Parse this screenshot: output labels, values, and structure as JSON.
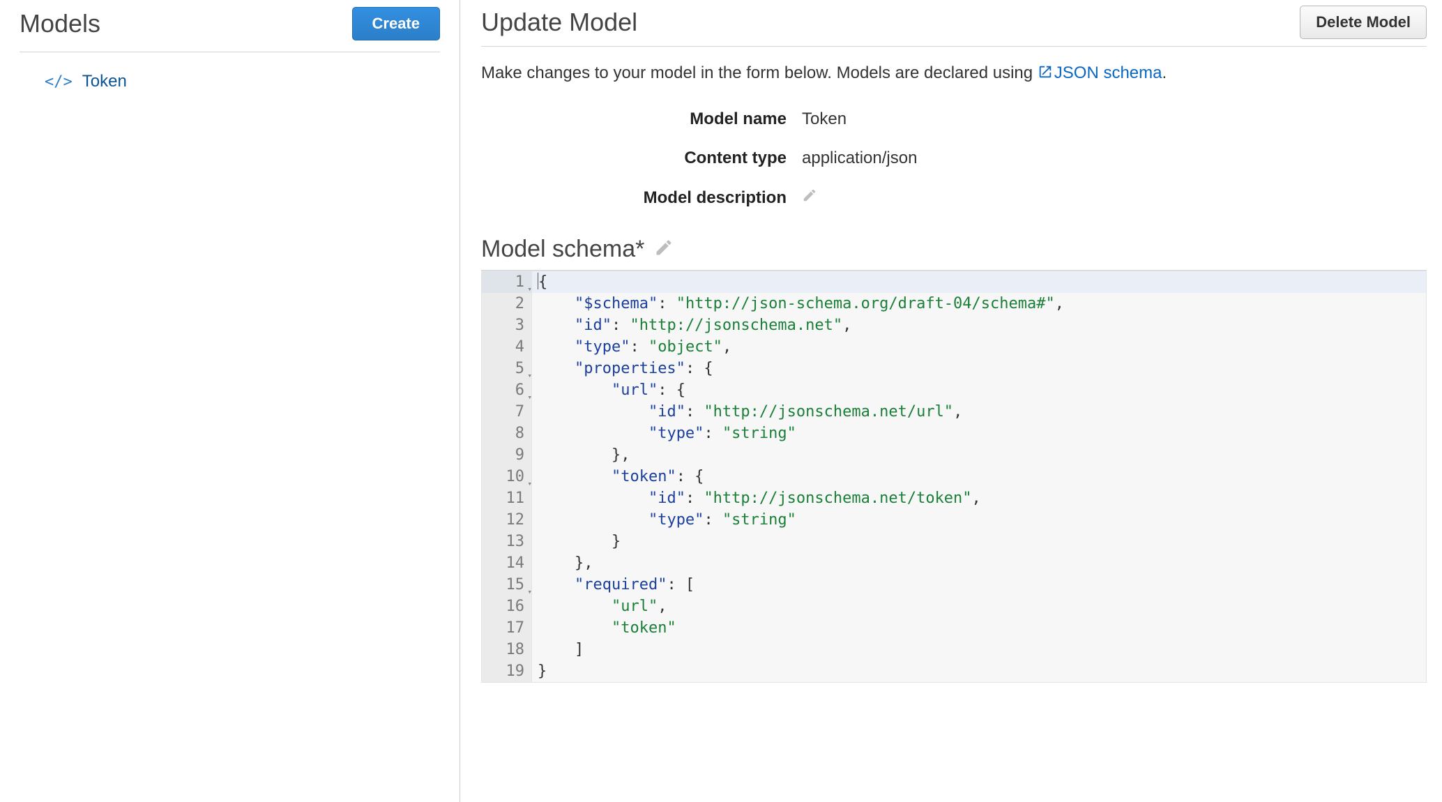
{
  "sidebar": {
    "title": "Models",
    "create_label": "Create",
    "items": [
      {
        "label": "Token",
        "icon": "code-icon"
      }
    ]
  },
  "main": {
    "title": "Update Model",
    "delete_label": "Delete Model",
    "description_prefix": "Make changes to your model in the form below. Models are declared using ",
    "schema_link_text": "JSON schema",
    "description_suffix": ".",
    "fields": {
      "model_name_label": "Model name",
      "model_name_value": "Token",
      "content_type_label": "Content type",
      "content_type_value": "application/json",
      "model_description_label": "Model description"
    },
    "schema_section_title": "Model schema*"
  },
  "schema_code": {
    "lines": [
      {
        "n": 1,
        "foldable": true,
        "indent": 0,
        "tokens": [
          [
            "punc",
            "{"
          ]
        ]
      },
      {
        "n": 2,
        "foldable": false,
        "indent": 1,
        "tokens": [
          [
            "key",
            "\"$schema\""
          ],
          [
            "punc",
            ": "
          ],
          [
            "str",
            "\"http://json-schema.org/draft-04/schema#\""
          ],
          [
            "punc",
            ","
          ]
        ]
      },
      {
        "n": 3,
        "foldable": false,
        "indent": 1,
        "tokens": [
          [
            "key",
            "\"id\""
          ],
          [
            "punc",
            ": "
          ],
          [
            "str",
            "\"http://jsonschema.net\""
          ],
          [
            "punc",
            ","
          ]
        ]
      },
      {
        "n": 4,
        "foldable": false,
        "indent": 1,
        "tokens": [
          [
            "key",
            "\"type\""
          ],
          [
            "punc",
            ": "
          ],
          [
            "str",
            "\"object\""
          ],
          [
            "punc",
            ","
          ]
        ]
      },
      {
        "n": 5,
        "foldable": true,
        "indent": 1,
        "tokens": [
          [
            "key",
            "\"properties\""
          ],
          [
            "punc",
            ": {"
          ]
        ]
      },
      {
        "n": 6,
        "foldable": true,
        "indent": 2,
        "tokens": [
          [
            "key",
            "\"url\""
          ],
          [
            "punc",
            ": {"
          ]
        ]
      },
      {
        "n": 7,
        "foldable": false,
        "indent": 3,
        "tokens": [
          [
            "key",
            "\"id\""
          ],
          [
            "punc",
            ": "
          ],
          [
            "str",
            "\"http://jsonschema.net/url\""
          ],
          [
            "punc",
            ","
          ]
        ]
      },
      {
        "n": 8,
        "foldable": false,
        "indent": 3,
        "tokens": [
          [
            "key",
            "\"type\""
          ],
          [
            "punc",
            ": "
          ],
          [
            "str",
            "\"string\""
          ]
        ]
      },
      {
        "n": 9,
        "foldable": false,
        "indent": 2,
        "tokens": [
          [
            "punc",
            "},"
          ]
        ]
      },
      {
        "n": 10,
        "foldable": true,
        "indent": 2,
        "tokens": [
          [
            "key",
            "\"token\""
          ],
          [
            "punc",
            ": {"
          ]
        ]
      },
      {
        "n": 11,
        "foldable": false,
        "indent": 3,
        "tokens": [
          [
            "key",
            "\"id\""
          ],
          [
            "punc",
            ": "
          ],
          [
            "str",
            "\"http://jsonschema.net/token\""
          ],
          [
            "punc",
            ","
          ]
        ]
      },
      {
        "n": 12,
        "foldable": false,
        "indent": 3,
        "tokens": [
          [
            "key",
            "\"type\""
          ],
          [
            "punc",
            ": "
          ],
          [
            "str",
            "\"string\""
          ]
        ]
      },
      {
        "n": 13,
        "foldable": false,
        "indent": 2,
        "tokens": [
          [
            "punc",
            "}"
          ]
        ]
      },
      {
        "n": 14,
        "foldable": false,
        "indent": 1,
        "tokens": [
          [
            "punc",
            "},"
          ]
        ]
      },
      {
        "n": 15,
        "foldable": true,
        "indent": 1,
        "tokens": [
          [
            "key",
            "\"required\""
          ],
          [
            "punc",
            ": ["
          ]
        ]
      },
      {
        "n": 16,
        "foldable": false,
        "indent": 2,
        "tokens": [
          [
            "str",
            "\"url\""
          ],
          [
            "punc",
            ","
          ]
        ]
      },
      {
        "n": 17,
        "foldable": false,
        "indent": 2,
        "tokens": [
          [
            "str",
            "\"token\""
          ]
        ]
      },
      {
        "n": 18,
        "foldable": false,
        "indent": 1,
        "tokens": [
          [
            "punc",
            "]"
          ]
        ]
      },
      {
        "n": 19,
        "foldable": false,
        "indent": 0,
        "tokens": [
          [
            "punc",
            "}"
          ]
        ]
      }
    ],
    "active_line": 1
  }
}
